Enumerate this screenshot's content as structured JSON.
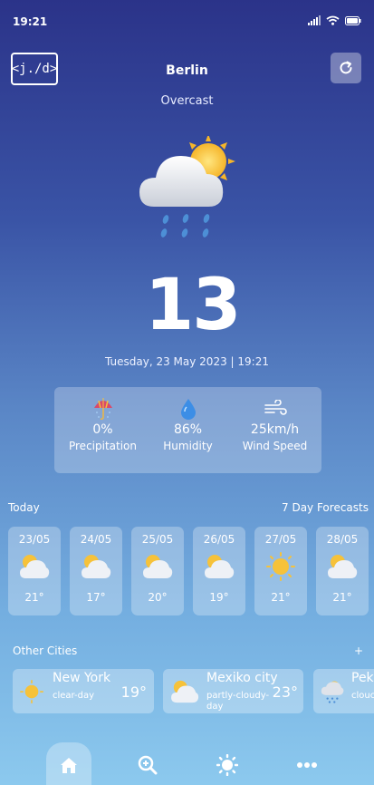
{
  "status": {
    "time": "19:21"
  },
  "header": {
    "logo_text": "<j./d>",
    "city": "Berlin",
    "condition": "Overcast"
  },
  "current": {
    "temperature": "13",
    "degree_symbol": "°",
    "datetime": "Tuesday, 23 May 2023 | 19:21"
  },
  "stats": [
    {
      "value": "0%",
      "label": "Precipitation",
      "icon": "umbrella-icon"
    },
    {
      "value": "86%",
      "label": "Humidity",
      "icon": "water-drop-icon"
    },
    {
      "value": "25km/h",
      "label": "Wind Speed",
      "icon": "wind-icon"
    }
  ],
  "forecast_header": {
    "left": "Today",
    "right": "7 Day Forecasts"
  },
  "days": [
    {
      "date": "23/05",
      "temp": "21°",
      "icon": "partly-cloudy-icon"
    },
    {
      "date": "24/05",
      "temp": "17°",
      "icon": "partly-cloudy-icon"
    },
    {
      "date": "25/05",
      "temp": "20°",
      "icon": "partly-cloudy-icon"
    },
    {
      "date": "26/05",
      "temp": "19°",
      "icon": "partly-cloudy-icon"
    },
    {
      "date": "27/05",
      "temp": "21°",
      "icon": "sun-icon"
    },
    {
      "date": "28/05",
      "temp": "21°",
      "icon": "partly-cloudy-icon"
    }
  ],
  "other_cities": {
    "label": "Other Cities",
    "add": "+",
    "items": [
      {
        "name": "New York",
        "desc": "clear-day",
        "temp": "19°",
        "icon": "sun-icon"
      },
      {
        "name": "Mexiko city",
        "desc": "partly-cloudy-day",
        "temp": "23°",
        "icon": "partly-cloudy-icon"
      },
      {
        "name": "Pek",
        "desc": "clouc",
        "temp": "",
        "icon": "rain-cloud-icon"
      }
    ]
  },
  "nav": [
    "home",
    "search",
    "weather",
    "more"
  ],
  "colors": {
    "accent_sun": "#f6c23a",
    "bg_top": "#2b3389",
    "bg_bottom": "#8cc9ee"
  }
}
